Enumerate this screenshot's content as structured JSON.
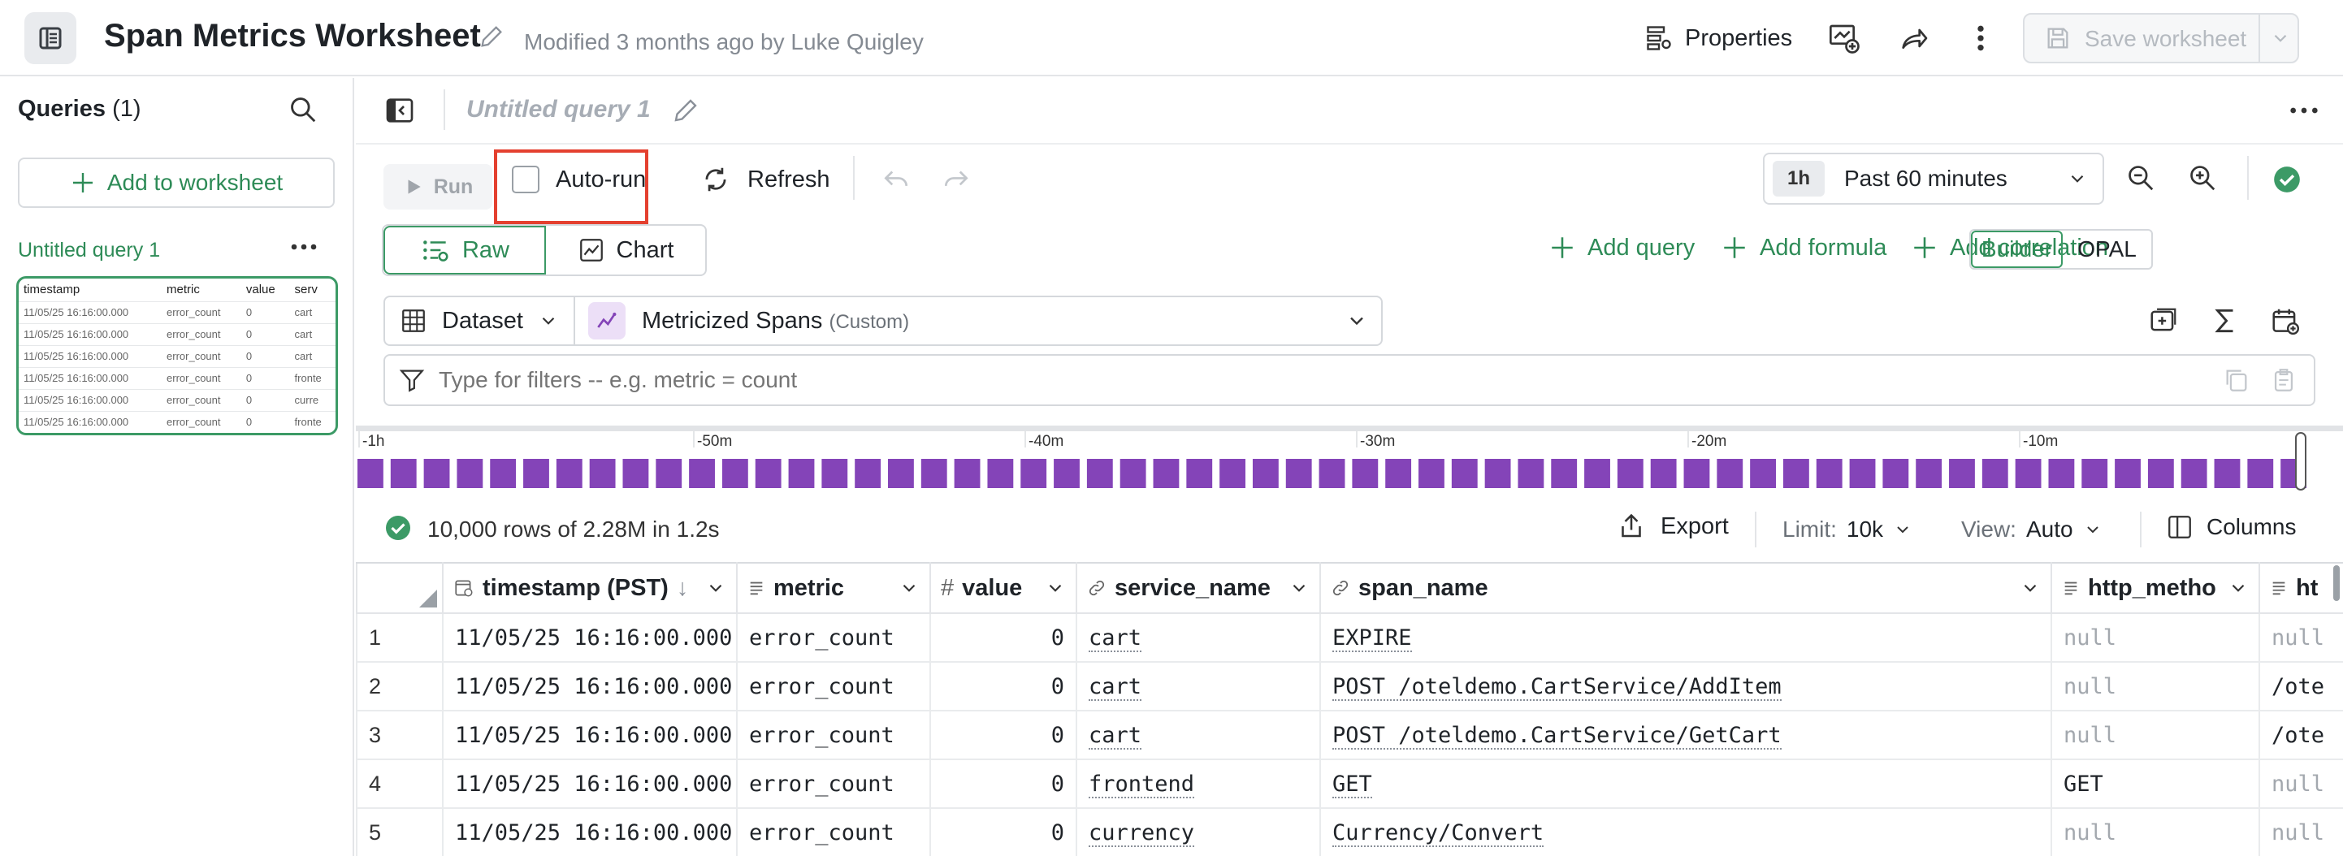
{
  "header": {
    "title": "Span Metrics Worksheet",
    "modified": "Modified 3 months ago by Luke Quigley",
    "properties_label": "Properties",
    "save_label": "Save worksheet"
  },
  "sidebar": {
    "queries_label": "Queries",
    "queries_count": "(1)",
    "add_label": "Add to worksheet",
    "query_name": "Untitled query 1",
    "thumb_headers": [
      "timestamp",
      "metric",
      "value",
      "serv"
    ],
    "thumb_rows": [
      [
        "11/05/25 16:16:00.000",
        "error_count",
        "0",
        "cart"
      ],
      [
        "11/05/25 16:16:00.000",
        "error_count",
        "0",
        "cart"
      ],
      [
        "11/05/25 16:16:00.000",
        "error_count",
        "0",
        "cart"
      ],
      [
        "11/05/25 16:16:00.000",
        "error_count",
        "0",
        "fronte"
      ],
      [
        "11/05/25 16:16:00.000",
        "error_count",
        "0",
        "curre"
      ],
      [
        "11/05/25 16:16:00.000",
        "error_count",
        "0",
        "fronte"
      ]
    ]
  },
  "query": {
    "title": "Untitled query 1",
    "run_label": "Run",
    "autorun_label": "Auto-run",
    "autorun_checked": false,
    "refresh_label": "Refresh",
    "time_chip": "1h",
    "time_range": "Past 60 minutes",
    "view_raw": "Raw",
    "view_chart": "Chart",
    "add_query": "Add query",
    "add_formula": "Add formula",
    "add_correlation": "Add correlation",
    "mode_builder": "Builder",
    "mode_opal": "OPAL",
    "dataset_label": "Dataset",
    "dataset_name": "Metricized Spans",
    "dataset_tag": "(Custom)",
    "filter_placeholder": "Type for filters -- e.g. metric = count"
  },
  "histogram": {
    "ticks": [
      "-1h",
      "-50m",
      "-40m",
      "-30m",
      "-20m",
      "-10m"
    ],
    "bar_color": "#8444b8",
    "bar_levels": [
      0.9,
      0.9,
      0.9,
      0.9,
      0.9,
      0.9,
      0.9,
      0.9,
      0.9,
      0.9,
      0.9,
      0.9,
      0.9,
      0.9,
      0.9,
      0.9,
      0.9,
      0.9,
      0.9,
      0.9,
      0.9,
      0.9,
      0.9,
      0.9,
      0.9,
      0.9,
      0.9,
      0.9,
      0.9,
      0.9,
      0.9,
      0.9,
      0.9,
      0.9,
      0.9,
      0.9,
      0.9,
      0.9,
      0.9,
      0.9,
      0.9,
      0.9,
      0.9,
      0.9,
      0.9,
      0.9,
      0.9,
      0.9,
      0.9,
      0.9,
      0.9,
      0.9,
      0.9,
      0.9,
      0.9,
      0.9,
      0.9,
      0.9,
      0.9,
      0.9,
      0.9,
      0.9,
      0.9,
      0.9,
      0.9,
      0.9,
      0.9,
      0.9,
      0.9,
      0.9,
      0.9,
      0.9,
      0.9,
      0.9,
      0.9,
      0.9,
      0.9,
      0.9,
      0.9,
      0.9,
      0.9,
      0.9,
      0.9,
      0.9,
      0.9,
      0.9,
      0.9,
      0.9,
      0.9,
      0.9,
      0.9,
      0.9,
      0.9,
      0.9,
      0.9,
      0.9,
      0.9,
      0.9,
      0.9,
      0.9,
      0.9,
      0.9,
      0.9,
      0.9,
      0.9,
      0.9,
      0.9,
      0.9,
      0.9,
      0.9,
      0.9,
      0.9,
      0.9,
      0.9,
      0.9,
      0.9,
      0.9,
      0.9,
      0.9,
      0.9,
      0.9,
      0.9,
      0.9,
      0.9,
      0.9,
      0.9,
      0.9,
      0.9,
      0.9,
      0.9,
      0.9,
      0.9,
      0.9,
      0.9,
      0.9,
      0.9,
      0.9,
      0.9,
      0.9,
      0.9,
      0.9,
      0.9,
      0.9,
      0.9,
      0.9,
      0.9,
      0.9,
      0.9,
      0.9,
      0.9,
      0.9,
      0.9,
      0.9,
      0.9,
      0.9,
      0.9,
      0.9,
      0.9,
      0.9,
      0.9,
      0.9,
      0.9,
      0.9,
      0.9,
      0.9,
      0.9,
      0.9,
      0.9,
      0.9,
      0.9,
      0.9,
      0.9,
      0.9,
      0.9,
      0.9,
      0.9,
      0.9,
      0.9,
      0.9,
      0.9,
      0.9,
      0.9,
      0.9,
      0.9,
      0.9,
      0.9,
      0.9,
      0.9,
      0.9,
      0.9,
      0.9,
      0.9,
      0.9,
      0.9,
      0.9,
      0.9,
      0.9,
      0.9,
      0.9,
      0.9,
      0.9,
      0.9,
      0.9,
      0.9,
      0.9,
      0.9,
      0.9,
      0.9,
      0.9,
      0.9,
      0.9,
      0.9,
      0.9,
      0.9,
      0.9,
      0.9,
      0.9,
      0.9,
      0.9,
      0.9,
      0.9,
      0.9,
      0.9,
      0.9,
      0.9,
      0.9,
      0.9,
      0.9,
      0.9,
      0.9,
      0.9,
      0.9,
      0.9,
      0.9,
      0.9,
      0.9,
      0.9,
      0.9,
      0.9,
      0.9,
      0.9,
      0.9,
      0.9,
      0.9,
      0.9,
      0.9,
      0.9,
      0.9,
      0.9,
      0.9,
      0.9,
      0.9,
      0.9,
      0.9,
      0.9,
      0.9,
      0.9
    ]
  },
  "results": {
    "summary": "10,000 rows of 2.28M in 1.2s",
    "export_label": "Export",
    "limit_label": "Limit:",
    "limit_value": "10k",
    "view_label": "View:",
    "view_value": "Auto",
    "columns_label": "Columns",
    "columns": [
      "timestamp (PST)",
      "metric",
      "value",
      "service_name",
      "span_name",
      "http_metho",
      "ht"
    ],
    "rows": [
      [
        "1",
        "11/05/25 16:16:00.000",
        "error_count",
        "0",
        "cart",
        "EXPIRE",
        "null",
        "null"
      ],
      [
        "2",
        "11/05/25 16:16:00.000",
        "error_count",
        "0",
        "cart",
        "POST /oteldemo.CartService/AddItem",
        "null",
        "/ote"
      ],
      [
        "3",
        "11/05/25 16:16:00.000",
        "error_count",
        "0",
        "cart",
        "POST /oteldemo.CartService/GetCart",
        "null",
        "/ote"
      ],
      [
        "4",
        "11/05/25 16:16:00.000",
        "error_count",
        "0",
        "frontend",
        "GET",
        "GET",
        "null"
      ],
      [
        "5",
        "11/05/25 16:16:00.000",
        "error_count",
        "0",
        "currency",
        "Currency/Convert",
        "null",
        "null"
      ]
    ]
  },
  "colors": {
    "accent": "#2e8b57",
    "highlight": "#e4402f",
    "histogram": "#8444b8"
  }
}
